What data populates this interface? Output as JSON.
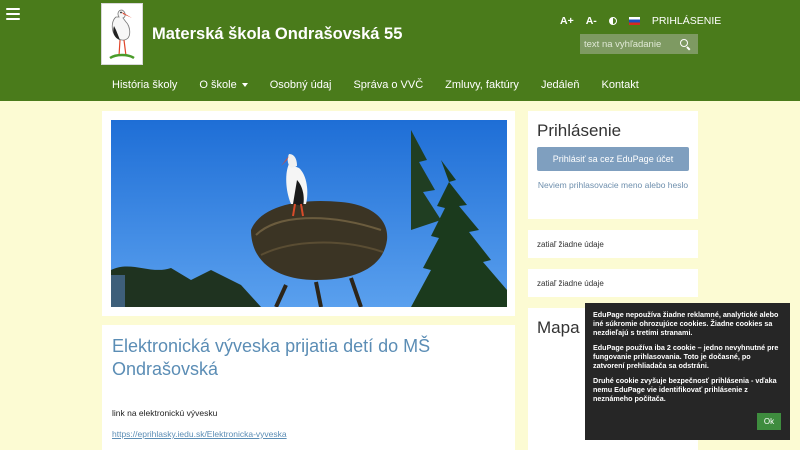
{
  "header": {
    "site_title": "Materská škola Ondrašovská 55",
    "font_increase": "A+",
    "font_decrease": "A-",
    "login_link": "PRIHLÁSENIE",
    "search_placeholder": "text na vyhľadanie"
  },
  "nav": {
    "items": [
      {
        "label": "História školy"
      },
      {
        "label": "O škole"
      },
      {
        "label": "Osobný údaj"
      },
      {
        "label": "Správa o VVČ"
      },
      {
        "label": "Zmluvy, faktúry"
      },
      {
        "label": "Jedáleň"
      },
      {
        "label": "Kontakt"
      }
    ]
  },
  "article": {
    "title": "Elektronická vývesk​a prijatia detí do MŠ Ondrašovská",
    "text": "link na elektronickú vývesku",
    "link": "https://eprihlasky.iedu.sk/Elektronicka-vyveska"
  },
  "login": {
    "title": "Prihlásenie",
    "button": "Prihlásiť sa cez EduPage účet",
    "forgot": "Neviem prihlasovacie meno alebo heslo"
  },
  "widgets": {
    "info1": "zatiaľ žiadne údaje",
    "info2": "zatiaľ žiadne údaje",
    "map_title": "Mapa"
  },
  "cookie": {
    "p1": "EduPage nepoužíva žiadne reklamné, analytické alebo iné súkromie ohrozujúce cookies. Žiadne cookies sa nezdieľajú s tretími stranami.",
    "p2": "EduPage používa iba 2 cookie – jedno nevyhnutné pre fungovanie prihlasovania. Toto je dočasné, po zatvorení prehliadača sa odstráni.",
    "p3": "Druhé cookie zvyšuje bezpečnosť prihlásenia - vďaka nemu EduPage vie identifikovať prihlásenie z neznámeho počítača.",
    "ok": "Ok"
  },
  "colors": {
    "header_green": "#4a7b1b",
    "page_bg": "#fcfbd3",
    "link_blue": "#5b8db5",
    "button_blue": "#7f9fbf"
  }
}
